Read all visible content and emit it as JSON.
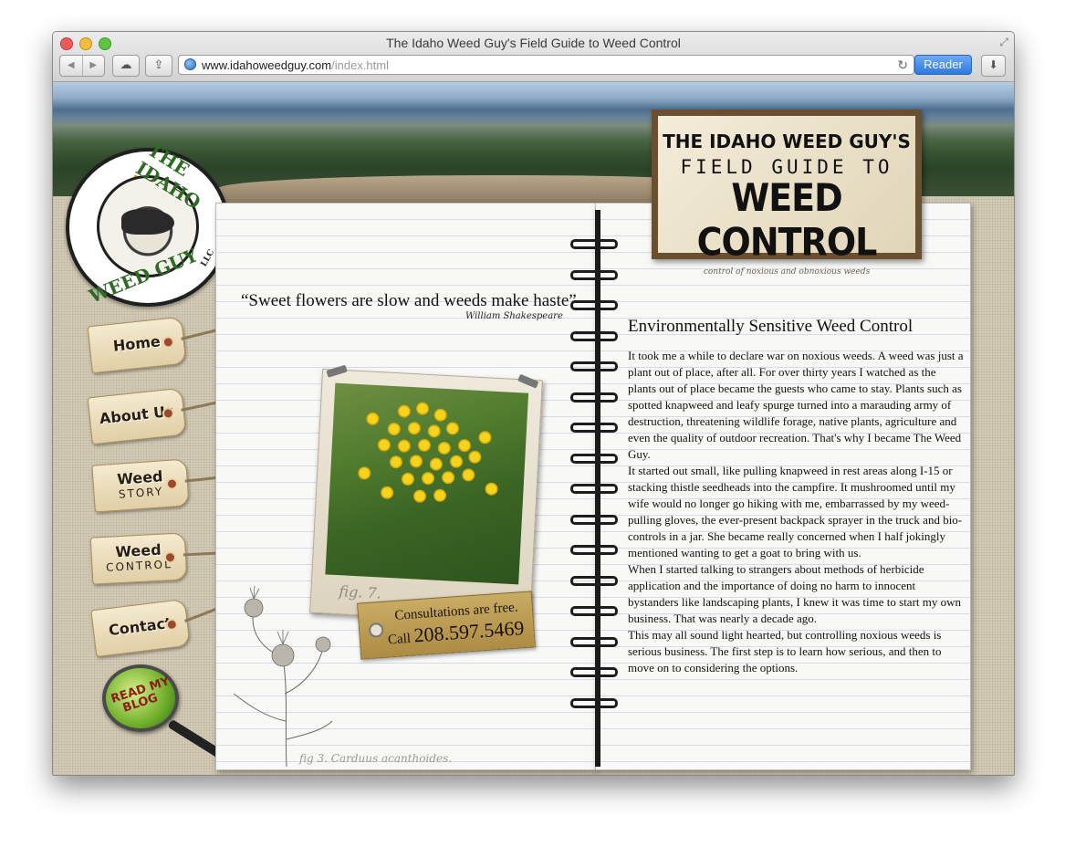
{
  "browser": {
    "window_title": "The Idaho Weed Guy's Field Guide to Weed Control",
    "url_host": "www.idahoweedguy.com",
    "url_path": "/index.html",
    "reader_label": "Reader",
    "back_glyph": "◀",
    "forward_glyph": "▶",
    "icons": [
      "cloud-icon",
      "share-icon",
      "globe-icon",
      "reload-icon",
      "download-icon",
      "fullscreen-icon"
    ]
  },
  "logo": {
    "line1": "THE IDAHO",
    "line2": "WEED GUY",
    "suffix": "LLC"
  },
  "nav": {
    "items": [
      {
        "line1": "Home",
        "line2": ""
      },
      {
        "line1": "About Us",
        "line2": ""
      },
      {
        "line1": "Weed",
        "line2": "STORY"
      },
      {
        "line1": "Weed",
        "line2": "CONTROL"
      },
      {
        "line1": "Contact",
        "line2": ""
      }
    ]
  },
  "blog": {
    "line1": "READ MY",
    "line2": "BLOG"
  },
  "quote": {
    "text": "“Sweet flowers are slow and weeds make haste”",
    "author": "William Shakespeare"
  },
  "photo": {
    "fig_label": "fig. 7."
  },
  "consult": {
    "line1": "Consultations are free.",
    "call": "Call",
    "phone": "208.597.5469"
  },
  "sketch_caption": "fig 3. Carduus acanthoides.",
  "sign": {
    "line1": "THE IDAHO WEED GUY'S",
    "line2": "FIELD GUIDE TO",
    "line3": "WEED CONTROL",
    "tagline": "control of noxious and obnoxious weeds"
  },
  "article": {
    "title": "Environmentally Sensitive Weed Control",
    "paragraphs": [
      "It took me a while to declare war on noxious weeds. A weed was just a plant out of place, after all. For over thirty years I watched as the plants out of place became the guests who came to stay. Plants such as spotted knapweed and leafy spurge turned into a marauding army of destruction, threatening wildlife forage, native plants, agriculture and even the quality of outdoor recreation. That's why I became The Weed Guy.",
      "It started out small, like pulling knapweed in rest areas along I-15 or stacking thistle seedheads into the campfire. It mushroomed until my wife would no longer go hiking with me, embarrassed by my weed-pulling gloves, the ever-present backpack sprayer in the truck and bio-controls in a jar. She became really concerned when I half jokingly mentioned wanting to get a goat to bring with us.",
      "When I started talking to strangers about methods of herbicide application and the importance of doing no harm to innocent bystanders like landscaping plants, I knew it was time to start my own business. That was nearly a decade ago.",
      "This may all sound light hearted, but controlling noxious weeds is serious business. The first step is to learn how serious, and then to move on to considering the options."
    ]
  },
  "colors": {
    "linen": "#d3cbb6",
    "logo_green": "#2d6a23",
    "tag_paper": "#e0cfa6",
    "reader_blue": "#2d78e0"
  }
}
